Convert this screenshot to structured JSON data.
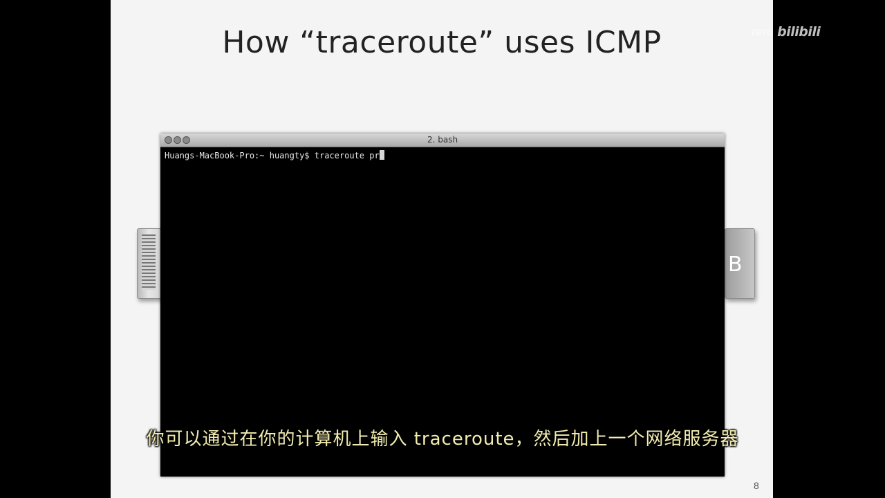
{
  "slide": {
    "title": "How “traceroute” uses ICMP",
    "page_number": "8",
    "server_b_label": "B"
  },
  "terminal": {
    "window_title": "2. bash",
    "prompt": "Huangs-MacBook-Pro:~ huangty$ ",
    "typed_command": "traceroute pr"
  },
  "subtitle": {
    "text": "你可以通过在你的计算机上输入 traceroute，然后加上一个网络服务器"
  },
  "watermark": {
    "user": "zero",
    "logo": "bilibili"
  }
}
